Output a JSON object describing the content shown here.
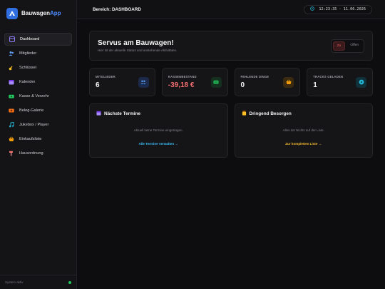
{
  "brand": {
    "name_part1": "Bauwagen",
    "name_part2": "App",
    "icon": "tent-icon"
  },
  "sidebar": {
    "items": [
      {
        "label": "Dashboard",
        "icon": "dashboard-icon",
        "active": true
      },
      {
        "label": "Mitglieder",
        "icon": "users-icon"
      },
      {
        "label": "Schlüssel",
        "icon": "key-icon"
      },
      {
        "label": "Kalender",
        "icon": "calendar-icon"
      },
      {
        "label": "Kasse & Verzehr",
        "icon": "cash-icon"
      },
      {
        "label": "Beleg-Galerie",
        "icon": "receipt-icon"
      },
      {
        "label": "Jukebox / Player",
        "icon": "music-icon"
      },
      {
        "label": "Einkaufsliste",
        "icon": "basket-icon"
      },
      {
        "label": "Hausordnung",
        "icon": "hammer-icon"
      }
    ],
    "footer": {
      "status_text": "System aktiv",
      "status_color": "#22c55e"
    }
  },
  "topbar": {
    "breadcrumb": "Bereich: DASHBOARD",
    "clock": "12:23:35 · 11.06.2026"
  },
  "hero": {
    "title": "Servus am Bauwagen!",
    "subtitle": "Hier ist der aktuelle Status und anstehende Aktivitäten.",
    "toggle": {
      "option_a": "Zu",
      "option_b": "Offen",
      "selected": "Zu"
    }
  },
  "stats": [
    {
      "label": "MITGLIEDER",
      "value": "6",
      "icon": "users-icon",
      "color": "#3b82f6"
    },
    {
      "label": "KASSENBESTAND",
      "value": "-39,18 €",
      "icon": "cash-icon",
      "color": "#22c55e",
      "negative": true
    },
    {
      "label": "FEHLENDE DINGE",
      "value": "0",
      "icon": "basket-icon",
      "color": "#f59e0b"
    },
    {
      "label": "TRACKS GELADEN",
      "value": "1",
      "icon": "disc-icon",
      "color": "#22b8d6"
    }
  ],
  "panels": {
    "termine": {
      "title": "Nächste Termine",
      "icon": "calendar-icon",
      "empty_text": "Aktuell keine Termine eingetragen.",
      "link_text": "Alle Termine verwalten →",
      "link_color": "#38bdf8"
    },
    "besorgen": {
      "title": "Dringend Besorgen",
      "icon": "jar-icon",
      "empty_text": "Alles da! Nichts auf der Liste.",
      "link_text": "Zur kompletten Liste →",
      "link_color": "#f5b82e"
    }
  },
  "colors": {
    "accent": "#2f6fe0",
    "danger": "#f26d6d"
  }
}
